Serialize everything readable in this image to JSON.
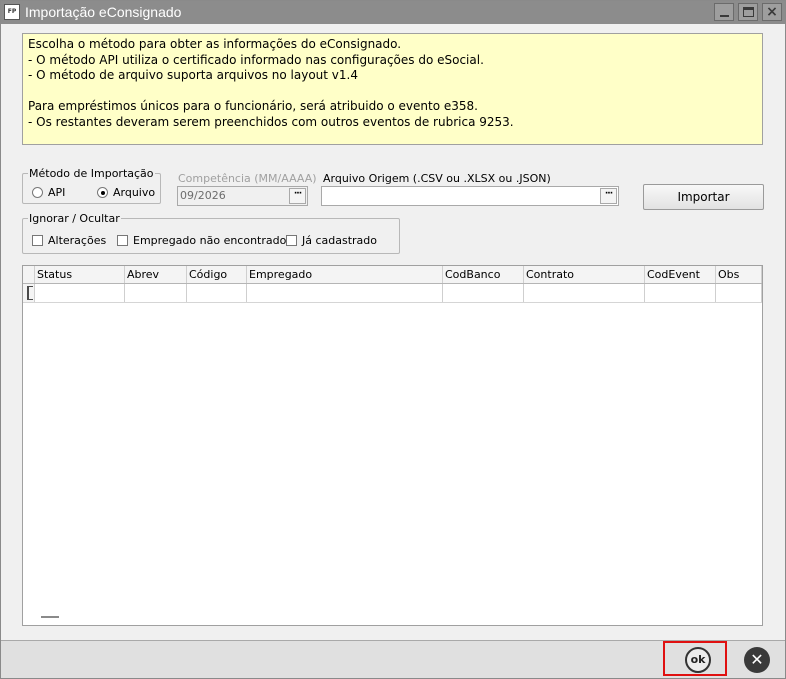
{
  "window": {
    "title": "Importação eConsignado",
    "app_icon_text": "FP",
    "app_icon": "app-logo-icon",
    "controls": [
      "minimize-icon",
      "maximize-icon",
      "close-icon"
    ]
  },
  "info": {
    "lines": [
      "Escolha o método para obter as informações do eConsignado.",
      "- O método API utiliza o certificado informado nas configurações do eSocial.",
      "- O método de arquivo suporta arquivos no layout v1.4",
      "",
      "Para empréstimos únicos para o funcionário, será atribuido o evento e358.",
      "- Os restantes deveram serem preenchidos com outros eventos de rubrica 9253."
    ],
    "background_color": "#ffffc8"
  },
  "metodo": {
    "legend": "Método de Importação",
    "options": [
      {
        "label": "API",
        "selected": false
      },
      {
        "label": "Arquivo",
        "selected": true
      }
    ]
  },
  "competencia": {
    "label": "Competência (MM/AAAA)",
    "value": "09/2026",
    "button_label": "···"
  },
  "arquivo": {
    "label": "Arquivo Origem (.CSV ou .XLSX ou .JSON)",
    "value": "",
    "button_label": "···"
  },
  "importar_button": {
    "label": "Importar"
  },
  "ignorar": {
    "legend": "Ignorar / Ocultar",
    "options": [
      {
        "label": "Alterações",
        "checked": false
      },
      {
        "label": "Empregado não encontrado",
        "checked": false
      },
      {
        "label": "Já cadastrado",
        "checked": false
      }
    ]
  },
  "grid": {
    "columns": [
      "Status",
      "Abrev",
      "Código",
      "Empregado",
      "CodBanco",
      "Contrato",
      "CodEvent",
      "Obs"
    ],
    "rows": [
      [
        "",
        "",
        "",
        "",
        "",
        "",
        "",
        ""
      ]
    ]
  },
  "footer": {
    "ok_label": "ok",
    "ok_icon": "ok-icon",
    "cancel_icon": "close-icon",
    "highlight_color": "#e01010"
  }
}
